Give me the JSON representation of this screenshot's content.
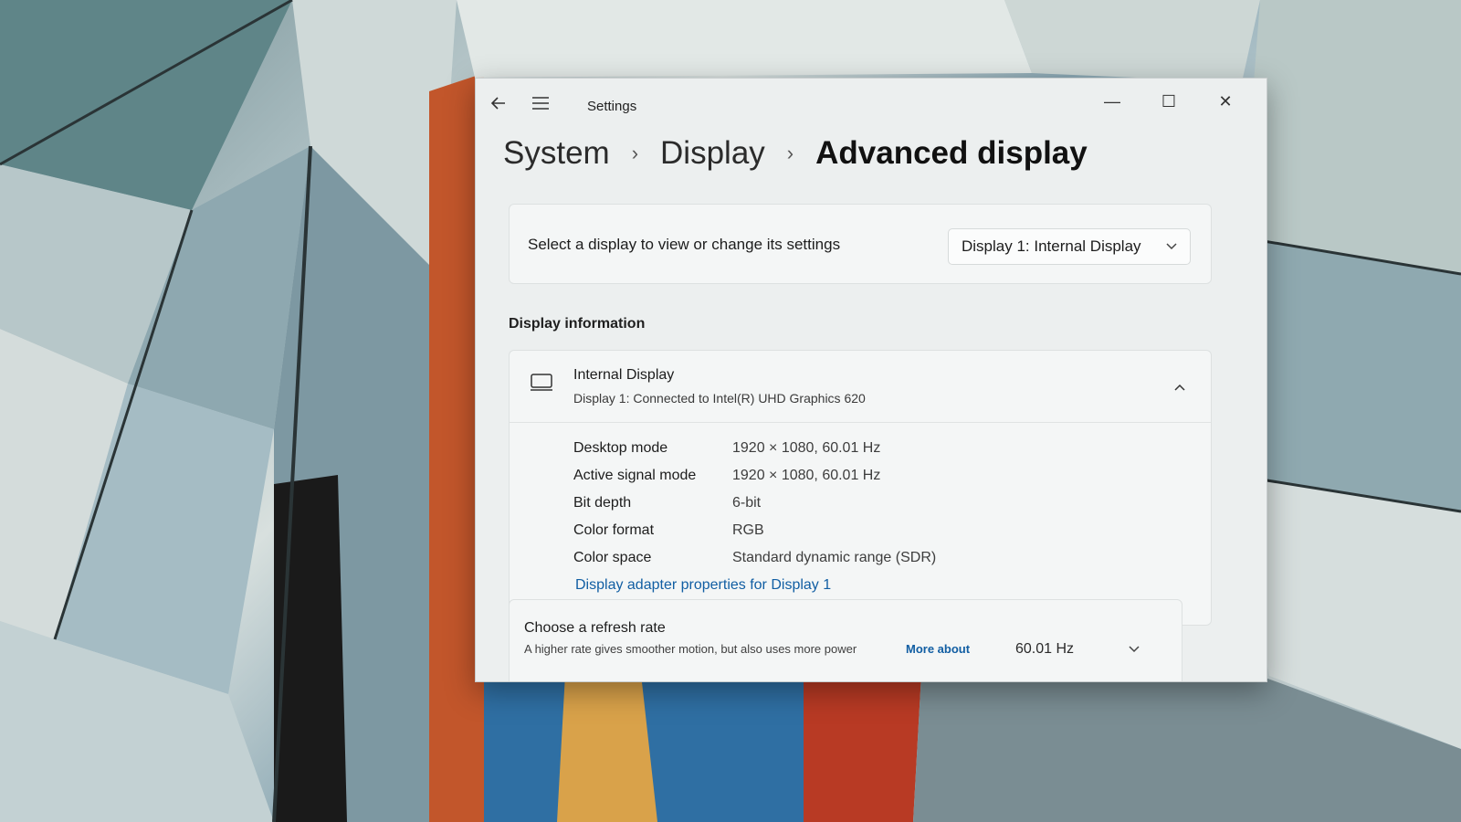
{
  "window": {
    "title": "Settings",
    "back_icon": "back-arrow-icon",
    "menu_icon": "hamburger-menu-icon",
    "minimize_glyph": "—",
    "maximize_glyph": "☐",
    "close_glyph": "✕"
  },
  "breadcrumb": {
    "items": [
      "System",
      "Display",
      "Advanced display"
    ],
    "separator": "›"
  },
  "display_select": {
    "label": "Select a display to view or change its settings",
    "selected": "Display 1: Internal Display"
  },
  "display_information": {
    "section_title": "Display information",
    "name": "Internal Display",
    "subtitle": "Display 1: Connected to Intel(R) UHD Graphics 620",
    "rows": [
      {
        "key": "Desktop mode",
        "value": "1920 × 1080, 60.01 Hz"
      },
      {
        "key": "Active signal mode",
        "value": "1920 × 1080, 60.01 Hz"
      },
      {
        "key": "Bit depth",
        "value": "6-bit"
      },
      {
        "key": "Color format",
        "value": "RGB"
      },
      {
        "key": "Color space",
        "value": "Standard dynamic range (SDR)"
      }
    ],
    "adapter_link": "Display adapter properties for Display 1"
  },
  "refresh_rate": {
    "title": "Choose a refresh rate",
    "description": "A higher rate gives smoother motion, but also uses more power",
    "more_link": "More about",
    "selected": "60.01 Hz"
  },
  "colors": {
    "accent": "#115ea3",
    "window_bg": "#ecefef"
  }
}
